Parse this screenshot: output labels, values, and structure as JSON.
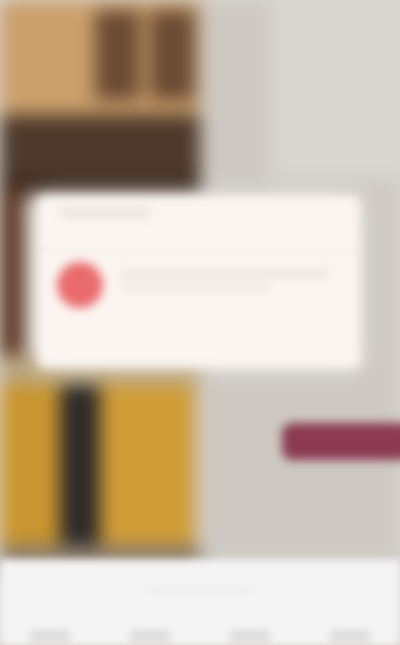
{
  "background": {
    "description_icons": "blurred-storefront-photo"
  },
  "toast": {
    "icon": "alert-circle-icon",
    "accent_color": "#ea6b6d"
  },
  "cta": {
    "color": "#8b3a52"
  },
  "tabbar": {
    "tab_count": 4
  }
}
